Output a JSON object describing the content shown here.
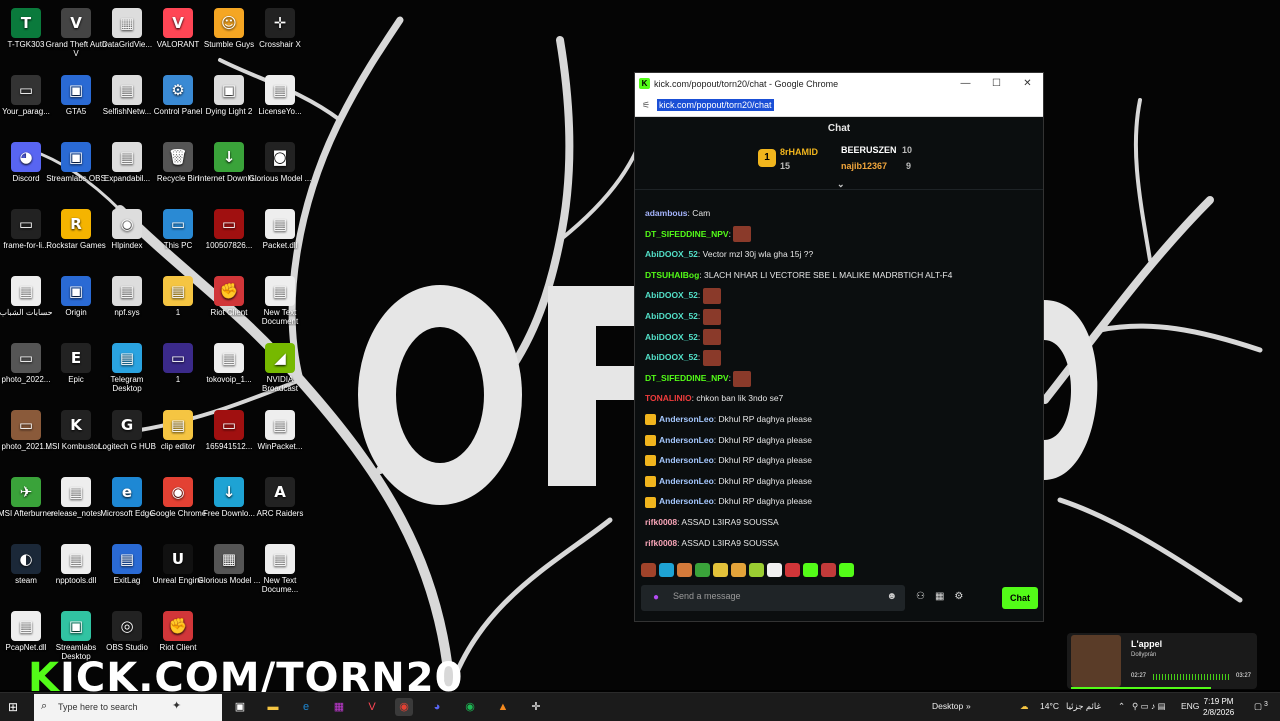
{
  "desktop": {
    "icons": [
      {
        "label": "T-TGK303",
        "glyph": "T",
        "color": "#0a7a3c"
      },
      {
        "label": "Grand Theft Auto V",
        "glyph": "V",
        "color": "#444"
      },
      {
        "label": "DataGridVie...",
        "glyph": "▦",
        "color": "#ddd"
      },
      {
        "label": "VALORANT",
        "glyph": "V",
        "color": "#ff4655"
      },
      {
        "label": "Stumble Guys",
        "glyph": "☺",
        "color": "#f5a623"
      },
      {
        "label": "Crosshair X",
        "glyph": "✛",
        "color": "#222"
      },
      {
        "label": "Your_parag...",
        "glyph": "▭",
        "color": "#333"
      },
      {
        "label": "GTA5",
        "glyph": "▣",
        "color": "#2a6ad4"
      },
      {
        "label": "SelfishNetw...",
        "glyph": "▤",
        "color": "#ddd"
      },
      {
        "label": "Control Panel",
        "glyph": "⚙",
        "color": "#3a8ad4"
      },
      {
        "label": "Dying Light 2",
        "glyph": "▣",
        "color": "#ddd"
      },
      {
        "label": "LicenseYo...",
        "glyph": "▤",
        "color": "#eee"
      },
      {
        "label": "Discord",
        "glyph": "◕",
        "color": "#5865f2"
      },
      {
        "label": "Streamlabs OBS",
        "glyph": "▣",
        "color": "#2a6ad4"
      },
      {
        "label": "Expandabil...",
        "glyph": "▤",
        "color": "#ddd"
      },
      {
        "label": "Recycle Bin",
        "glyph": "🗑",
        "color": "#555"
      },
      {
        "label": "Internet Downlo...",
        "glyph": "↓",
        "color": "#3aa33a"
      },
      {
        "label": "Glorious Model ...",
        "glyph": "◙",
        "color": "#222"
      },
      {
        "label": "frame-for-li...",
        "glyph": "▭",
        "color": "#222"
      },
      {
        "label": "Rockstar Games",
        "glyph": "R",
        "color": "#f5b400"
      },
      {
        "label": "Hlpindex",
        "glyph": "◉",
        "color": "#ddd"
      },
      {
        "label": "This PC",
        "glyph": "▭",
        "color": "#2a8ad4"
      },
      {
        "label": "100507826...",
        "glyph": "▭",
        "color": "#a01010"
      },
      {
        "label": "Packet.dll",
        "glyph": "▤",
        "color": "#eee"
      },
      {
        "label": "حسابات الشباب",
        "glyph": "▤",
        "color": "#eee"
      },
      {
        "label": "Origin",
        "glyph": "▣",
        "color": "#2a6ad4"
      },
      {
        "label": "npf.sys",
        "glyph": "▤",
        "color": "#ddd"
      },
      {
        "label": "1",
        "glyph": "▤",
        "color": "#f5c542"
      },
      {
        "label": "Riot Client",
        "glyph": "✊",
        "color": "#d13639"
      },
      {
        "label": "New Text Document",
        "glyph": "▤",
        "color": "#eee"
      },
      {
        "label": "photo_2022...",
        "glyph": "▭",
        "color": "#555"
      },
      {
        "label": "Epic",
        "glyph": "E",
        "color": "#222"
      },
      {
        "label": "Telegram Desktop",
        "glyph": "▤",
        "color": "#2aa3e0"
      },
      {
        "label": "1",
        "glyph": "▭",
        "color": "#3b2a8a"
      },
      {
        "label": "tokovoip_1...",
        "glyph": "▤",
        "color": "#eee"
      },
      {
        "label": "NVIDIA Broadcast",
        "glyph": "◢",
        "color": "#76b900"
      },
      {
        "label": "photo_2021...",
        "glyph": "▭",
        "color": "#8a5a3a"
      },
      {
        "label": "MSI Kombustor...",
        "glyph": "K",
        "color": "#222"
      },
      {
        "label": "Logitech G HUB",
        "glyph": "G",
        "color": "#222"
      },
      {
        "label": "clip editor",
        "glyph": "▤",
        "color": "#f5c542"
      },
      {
        "label": "165941512...",
        "glyph": "▭",
        "color": "#a01010"
      },
      {
        "label": "WinPacket...",
        "glyph": "▤",
        "color": "#eee"
      },
      {
        "label": "MSI Afterburner",
        "glyph": "✈",
        "color": "#3aa33a"
      },
      {
        "label": "release_notes",
        "glyph": "▤",
        "color": "#eee"
      },
      {
        "label": "Microsoft Edge",
        "glyph": "e",
        "color": "#1e88d4"
      },
      {
        "label": "Google Chrome",
        "glyph": "◉",
        "color": "#e34133"
      },
      {
        "label": "Free Downlo...",
        "glyph": "↓",
        "color": "#1ea3d4"
      },
      {
        "label": "ARC Raiders",
        "glyph": "A",
        "color": "#222"
      },
      {
        "label": "steam",
        "glyph": "◐",
        "color": "#1b2838"
      },
      {
        "label": "npptools.dll",
        "glyph": "▤",
        "color": "#eee"
      },
      {
        "label": "ExitLag",
        "glyph": "▤",
        "color": "#2a6ad4"
      },
      {
        "label": "Unreal Engine",
        "glyph": "U",
        "color": "#111"
      },
      {
        "label": "Glorious Model ...",
        "glyph": "▦",
        "color": "#555"
      },
      {
        "label": "New Text Docume...",
        "glyph": "▤",
        "color": "#eee"
      },
      {
        "label": "PcapNet.dll",
        "glyph": "▤",
        "color": "#eee"
      },
      {
        "label": "Streamlabs Desktop",
        "glyph": "▣",
        "color": "#31c3a2"
      },
      {
        "label": "OBS Studio",
        "glyph": "◎",
        "color": "#222"
      },
      {
        "label": "Riot Client",
        "glyph": "✊",
        "color": "#d13639"
      }
    ],
    "brand_k": "K",
    "brand_rest": "ICK.COM/TORN20"
  },
  "browser": {
    "title": "kick.com/popout/torn20/chat - Google Chrome",
    "url": "kick.com/popout/torn20/chat",
    "minimize": "—",
    "maximize": "☐",
    "close": "✕"
  },
  "chat": {
    "header": "Chat",
    "leaderboard": {
      "rank": "1",
      "first_name": "8rHAMID",
      "first_count": "15",
      "second_name": "BEERUSZEN",
      "second_count": "10",
      "third_name": "najib12367",
      "third_count": "9",
      "pin_icon": "pin-toggle"
    },
    "messages": [
      {
        "user": "adambous",
        "color": "#a5b4fc",
        "text": "Cam",
        "emote": false,
        "badge": false
      },
      {
        "user": "DT_SIFEDDINE_NPV",
        "color": "#53fc18",
        "text": "",
        "emote": true,
        "badge": false
      },
      {
        "user": "AbiDOOX_52",
        "color": "#53e0c8",
        "text": "Vector mzl 30j wla gha 15j ??",
        "emote": false,
        "badge": false
      },
      {
        "user": "DTSUHAIBog",
        "color": "#53fc18",
        "text": "3LACH NHAR LI VECTORE SBE L MALIKE MADRBTICH ALT-F4",
        "emote": false,
        "badge": false
      },
      {
        "user": "AbiDOOX_52",
        "color": "#53e0c8",
        "text": "",
        "emote": true,
        "badge": false
      },
      {
        "user": "AbiDOOX_52",
        "color": "#53e0c8",
        "text": "",
        "emote": true,
        "badge": false
      },
      {
        "user": "AbiDOOX_52",
        "color": "#53e0c8",
        "text": "",
        "emote": true,
        "badge": false
      },
      {
        "user": "AbiDOOX_52",
        "color": "#53e0c8",
        "text": "",
        "emote": true,
        "badge": false
      },
      {
        "user": "DT_SIFEDDINE_NPV",
        "color": "#53fc18",
        "text": "",
        "emote": true,
        "badge": false
      },
      {
        "user": "TONALINIO",
        "color": "#f03c3c",
        "text": "chkon ban lik 3ndo se7",
        "emote": false,
        "badge": false
      },
      {
        "user": "AndersonLeo",
        "color": "#a5c8ff",
        "text": "Dkhul RP daghya please",
        "emote": false,
        "badge": true
      },
      {
        "user": "AndersonLeo",
        "color": "#a5c8ff",
        "text": "Dkhul RP daghya please",
        "emote": false,
        "badge": true
      },
      {
        "user": "AndersonLeo",
        "color": "#a5c8ff",
        "text": "Dkhul RP daghya please",
        "emote": false,
        "badge": true
      },
      {
        "user": "AndersonLeo",
        "color": "#a5c8ff",
        "text": "Dkhul RP daghya please",
        "emote": false,
        "badge": true
      },
      {
        "user": "AndersonLeo",
        "color": "#a5c8ff",
        "text": "Dkhul RP daghya please",
        "emote": false,
        "badge": true
      },
      {
        "user": "rifk0008",
        "color": "#f8a5b8",
        "text": "ASSAD L3IRA9 SOUSSA",
        "emote": false,
        "badge": false
      },
      {
        "user": "rifk0008",
        "color": "#f8a5b8",
        "text": "ASSAD L3IRA9 SOUSSA",
        "emote": false,
        "badge": false
      }
    ],
    "input_placeholder": "Send a message",
    "send_label": "Chat",
    "emote_colors": [
      "#a0432a",
      "#1ea3d4",
      "#d47a3a",
      "#3aa33a",
      "#e3c23a",
      "#e3a33a",
      "#9acd32",
      "#f0f0f0",
      "#d13639",
      "#53fc18",
      "#c23a3a",
      "#53fc18"
    ]
  },
  "media": {
    "title": "L'appel",
    "artist": "Dollyprán",
    "elapsed": "02:27",
    "duration": "03:27"
  },
  "taskbar": {
    "search_placeholder": "Type here to search",
    "desktop_label": "Desktop",
    "chevron": "»",
    "weather": "14°C",
    "weather_text": "غائم جزئيا",
    "language": "ENG",
    "time": "7:19 PM",
    "date": "2/8/2026",
    "notifications": "3"
  }
}
